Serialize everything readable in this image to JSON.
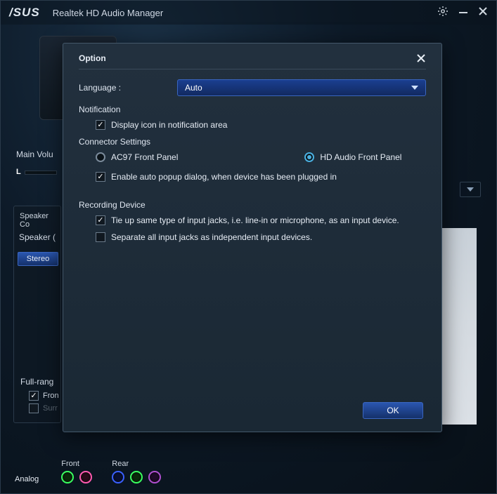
{
  "titlebar": {
    "logo": "/SUS",
    "title": "Realtek HD Audio Manager"
  },
  "main": {
    "volume_label": "Main Volu",
    "l": "L",
    "speaker_panel_hdr": "Speaker Co",
    "speaker_label": "Speaker (",
    "stereo": "Stereo",
    "fullrange": "Full-rang",
    "front": "Fron",
    "surr": "Surr"
  },
  "ports": {
    "analog": "Analog",
    "front": "Front",
    "rear": "Rear"
  },
  "dialog": {
    "title": "Option",
    "language_label": "Language :",
    "language_value": "Auto",
    "notification_h": "Notification",
    "notif_icon": "Display icon in notification area",
    "connector_h": "Connector Settings",
    "ac97": "AC97 Front Panel",
    "hdaudio": "HD Audio Front Panel",
    "auto_popup": "Enable auto popup dialog, when device has been plugged in",
    "recording_h": "Recording Device",
    "tie_up": "Tie up same type of input jacks, i.e. line-in or microphone, as an input device.",
    "separate": "Separate all input jacks as independent input devices.",
    "ok": "OK"
  }
}
